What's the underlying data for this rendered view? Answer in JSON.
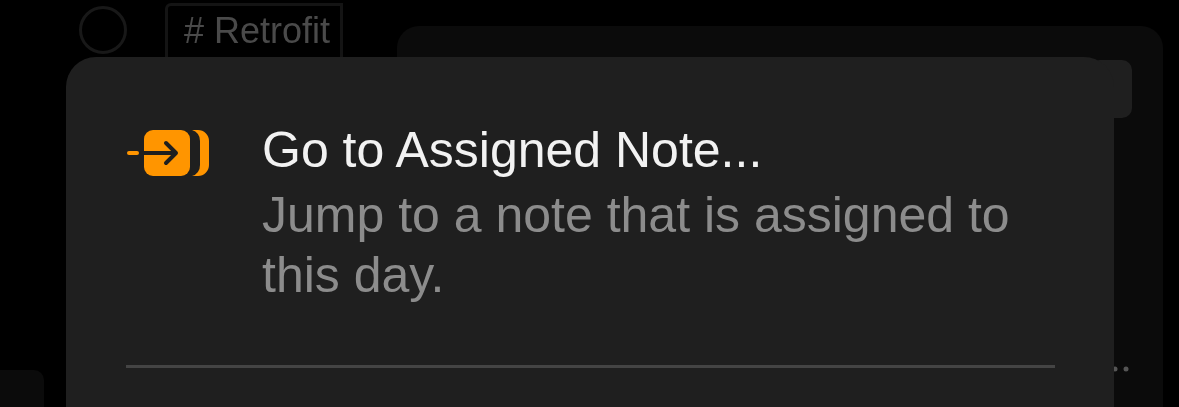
{
  "background": {
    "tag": "# Retrofit"
  },
  "sheet": {
    "action": {
      "title": "Go to Assigned Note...",
      "description": "Jump to a note that is assigned to this day."
    }
  }
}
